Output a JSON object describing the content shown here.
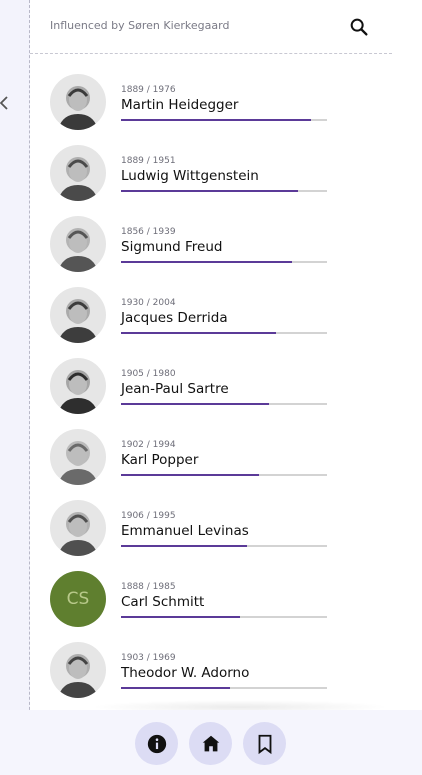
{
  "header": {
    "title": "Influenced by Søren Kierkegaard"
  },
  "people": [
    {
      "dates": "1889 / 1976",
      "name": "Martin Heidegger",
      "progress": 0.92,
      "avatar": "photo"
    },
    {
      "dates": "1889 / 1951",
      "name": "Ludwig Wittgenstein",
      "progress": 0.86,
      "avatar": "photo"
    },
    {
      "dates": "1856 / 1939",
      "name": "Sigmund Freud",
      "progress": 0.83,
      "avatar": "photo"
    },
    {
      "dates": "1930 / 2004",
      "name": "Jacques Derrida",
      "progress": 0.75,
      "avatar": "photo"
    },
    {
      "dates": "1905 / 1980",
      "name": "Jean-Paul Sartre",
      "progress": 0.72,
      "avatar": "photo"
    },
    {
      "dates": "1902 / 1994",
      "name": "Karl Popper",
      "progress": 0.67,
      "avatar": "photo"
    },
    {
      "dates": "1906 / 1995",
      "name": "Emmanuel Levinas",
      "progress": 0.61,
      "avatar": "photo"
    },
    {
      "dates": "1888 / 1985",
      "name": "Carl Schmitt",
      "progress": 0.58,
      "avatar": "initials",
      "initials": "CS",
      "avatar_color": "#5f7f2f"
    },
    {
      "dates": "1903 / 1969",
      "name": "Theodor W. Adorno",
      "progress": 0.53,
      "avatar": "photo"
    }
  ],
  "nav": {
    "info_icon": "info-icon",
    "home_icon": "home-icon",
    "bookmark_icon": "bookmark-icon"
  },
  "colors": {
    "accent": "#5b3a98",
    "rail": "#f3f3fc",
    "nav_button": "#dcdcf4"
  }
}
